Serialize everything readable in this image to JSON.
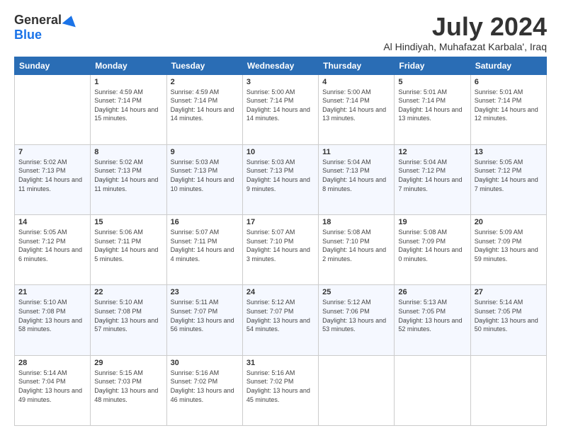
{
  "logo": {
    "general": "General",
    "blue": "Blue"
  },
  "title": "July 2024",
  "location": "Al Hindiyah, Muhafazat Karbala', Iraq",
  "days_header": [
    "Sunday",
    "Monday",
    "Tuesday",
    "Wednesday",
    "Thursday",
    "Friday",
    "Saturday"
  ],
  "weeks": [
    [
      {
        "day": "",
        "sunrise": "",
        "sunset": "",
        "daylight": ""
      },
      {
        "day": "1",
        "sunrise": "Sunrise: 4:59 AM",
        "sunset": "Sunset: 7:14 PM",
        "daylight": "Daylight: 14 hours and 15 minutes."
      },
      {
        "day": "2",
        "sunrise": "Sunrise: 4:59 AM",
        "sunset": "Sunset: 7:14 PM",
        "daylight": "Daylight: 14 hours and 14 minutes."
      },
      {
        "day": "3",
        "sunrise": "Sunrise: 5:00 AM",
        "sunset": "Sunset: 7:14 PM",
        "daylight": "Daylight: 14 hours and 14 minutes."
      },
      {
        "day": "4",
        "sunrise": "Sunrise: 5:00 AM",
        "sunset": "Sunset: 7:14 PM",
        "daylight": "Daylight: 14 hours and 13 minutes."
      },
      {
        "day": "5",
        "sunrise": "Sunrise: 5:01 AM",
        "sunset": "Sunset: 7:14 PM",
        "daylight": "Daylight: 14 hours and 13 minutes."
      },
      {
        "day": "6",
        "sunrise": "Sunrise: 5:01 AM",
        "sunset": "Sunset: 7:14 PM",
        "daylight": "Daylight: 14 hours and 12 minutes."
      }
    ],
    [
      {
        "day": "7",
        "sunrise": "Sunrise: 5:02 AM",
        "sunset": "Sunset: 7:13 PM",
        "daylight": "Daylight: 14 hours and 11 minutes."
      },
      {
        "day": "8",
        "sunrise": "Sunrise: 5:02 AM",
        "sunset": "Sunset: 7:13 PM",
        "daylight": "Daylight: 14 hours and 11 minutes."
      },
      {
        "day": "9",
        "sunrise": "Sunrise: 5:03 AM",
        "sunset": "Sunset: 7:13 PM",
        "daylight": "Daylight: 14 hours and 10 minutes."
      },
      {
        "day": "10",
        "sunrise": "Sunrise: 5:03 AM",
        "sunset": "Sunset: 7:13 PM",
        "daylight": "Daylight: 14 hours and 9 minutes."
      },
      {
        "day": "11",
        "sunrise": "Sunrise: 5:04 AM",
        "sunset": "Sunset: 7:13 PM",
        "daylight": "Daylight: 14 hours and 8 minutes."
      },
      {
        "day": "12",
        "sunrise": "Sunrise: 5:04 AM",
        "sunset": "Sunset: 7:12 PM",
        "daylight": "Daylight: 14 hours and 7 minutes."
      },
      {
        "day": "13",
        "sunrise": "Sunrise: 5:05 AM",
        "sunset": "Sunset: 7:12 PM",
        "daylight": "Daylight: 14 hours and 7 minutes."
      }
    ],
    [
      {
        "day": "14",
        "sunrise": "Sunrise: 5:05 AM",
        "sunset": "Sunset: 7:12 PM",
        "daylight": "Daylight: 14 hours and 6 minutes."
      },
      {
        "day": "15",
        "sunrise": "Sunrise: 5:06 AM",
        "sunset": "Sunset: 7:11 PM",
        "daylight": "Daylight: 14 hours and 5 minutes."
      },
      {
        "day": "16",
        "sunrise": "Sunrise: 5:07 AM",
        "sunset": "Sunset: 7:11 PM",
        "daylight": "Daylight: 14 hours and 4 minutes."
      },
      {
        "day": "17",
        "sunrise": "Sunrise: 5:07 AM",
        "sunset": "Sunset: 7:10 PM",
        "daylight": "Daylight: 14 hours and 3 minutes."
      },
      {
        "day": "18",
        "sunrise": "Sunrise: 5:08 AM",
        "sunset": "Sunset: 7:10 PM",
        "daylight": "Daylight: 14 hours and 2 minutes."
      },
      {
        "day": "19",
        "sunrise": "Sunrise: 5:08 AM",
        "sunset": "Sunset: 7:09 PM",
        "daylight": "Daylight: 14 hours and 0 minutes."
      },
      {
        "day": "20",
        "sunrise": "Sunrise: 5:09 AM",
        "sunset": "Sunset: 7:09 PM",
        "daylight": "Daylight: 13 hours and 59 minutes."
      }
    ],
    [
      {
        "day": "21",
        "sunrise": "Sunrise: 5:10 AM",
        "sunset": "Sunset: 7:08 PM",
        "daylight": "Daylight: 13 hours and 58 minutes."
      },
      {
        "day": "22",
        "sunrise": "Sunrise: 5:10 AM",
        "sunset": "Sunset: 7:08 PM",
        "daylight": "Daylight: 13 hours and 57 minutes."
      },
      {
        "day": "23",
        "sunrise": "Sunrise: 5:11 AM",
        "sunset": "Sunset: 7:07 PM",
        "daylight": "Daylight: 13 hours and 56 minutes."
      },
      {
        "day": "24",
        "sunrise": "Sunrise: 5:12 AM",
        "sunset": "Sunset: 7:07 PM",
        "daylight": "Daylight: 13 hours and 54 minutes."
      },
      {
        "day": "25",
        "sunrise": "Sunrise: 5:12 AM",
        "sunset": "Sunset: 7:06 PM",
        "daylight": "Daylight: 13 hours and 53 minutes."
      },
      {
        "day": "26",
        "sunrise": "Sunrise: 5:13 AM",
        "sunset": "Sunset: 7:05 PM",
        "daylight": "Daylight: 13 hours and 52 minutes."
      },
      {
        "day": "27",
        "sunrise": "Sunrise: 5:14 AM",
        "sunset": "Sunset: 7:05 PM",
        "daylight": "Daylight: 13 hours and 50 minutes."
      }
    ],
    [
      {
        "day": "28",
        "sunrise": "Sunrise: 5:14 AM",
        "sunset": "Sunset: 7:04 PM",
        "daylight": "Daylight: 13 hours and 49 minutes."
      },
      {
        "day": "29",
        "sunrise": "Sunrise: 5:15 AM",
        "sunset": "Sunset: 7:03 PM",
        "daylight": "Daylight: 13 hours and 48 minutes."
      },
      {
        "day": "30",
        "sunrise": "Sunrise: 5:16 AM",
        "sunset": "Sunset: 7:02 PM",
        "daylight": "Daylight: 13 hours and 46 minutes."
      },
      {
        "day": "31",
        "sunrise": "Sunrise: 5:16 AM",
        "sunset": "Sunset: 7:02 PM",
        "daylight": "Daylight: 13 hours and 45 minutes."
      },
      {
        "day": "",
        "sunrise": "",
        "sunset": "",
        "daylight": ""
      },
      {
        "day": "",
        "sunrise": "",
        "sunset": "",
        "daylight": ""
      },
      {
        "day": "",
        "sunrise": "",
        "sunset": "",
        "daylight": ""
      }
    ]
  ]
}
